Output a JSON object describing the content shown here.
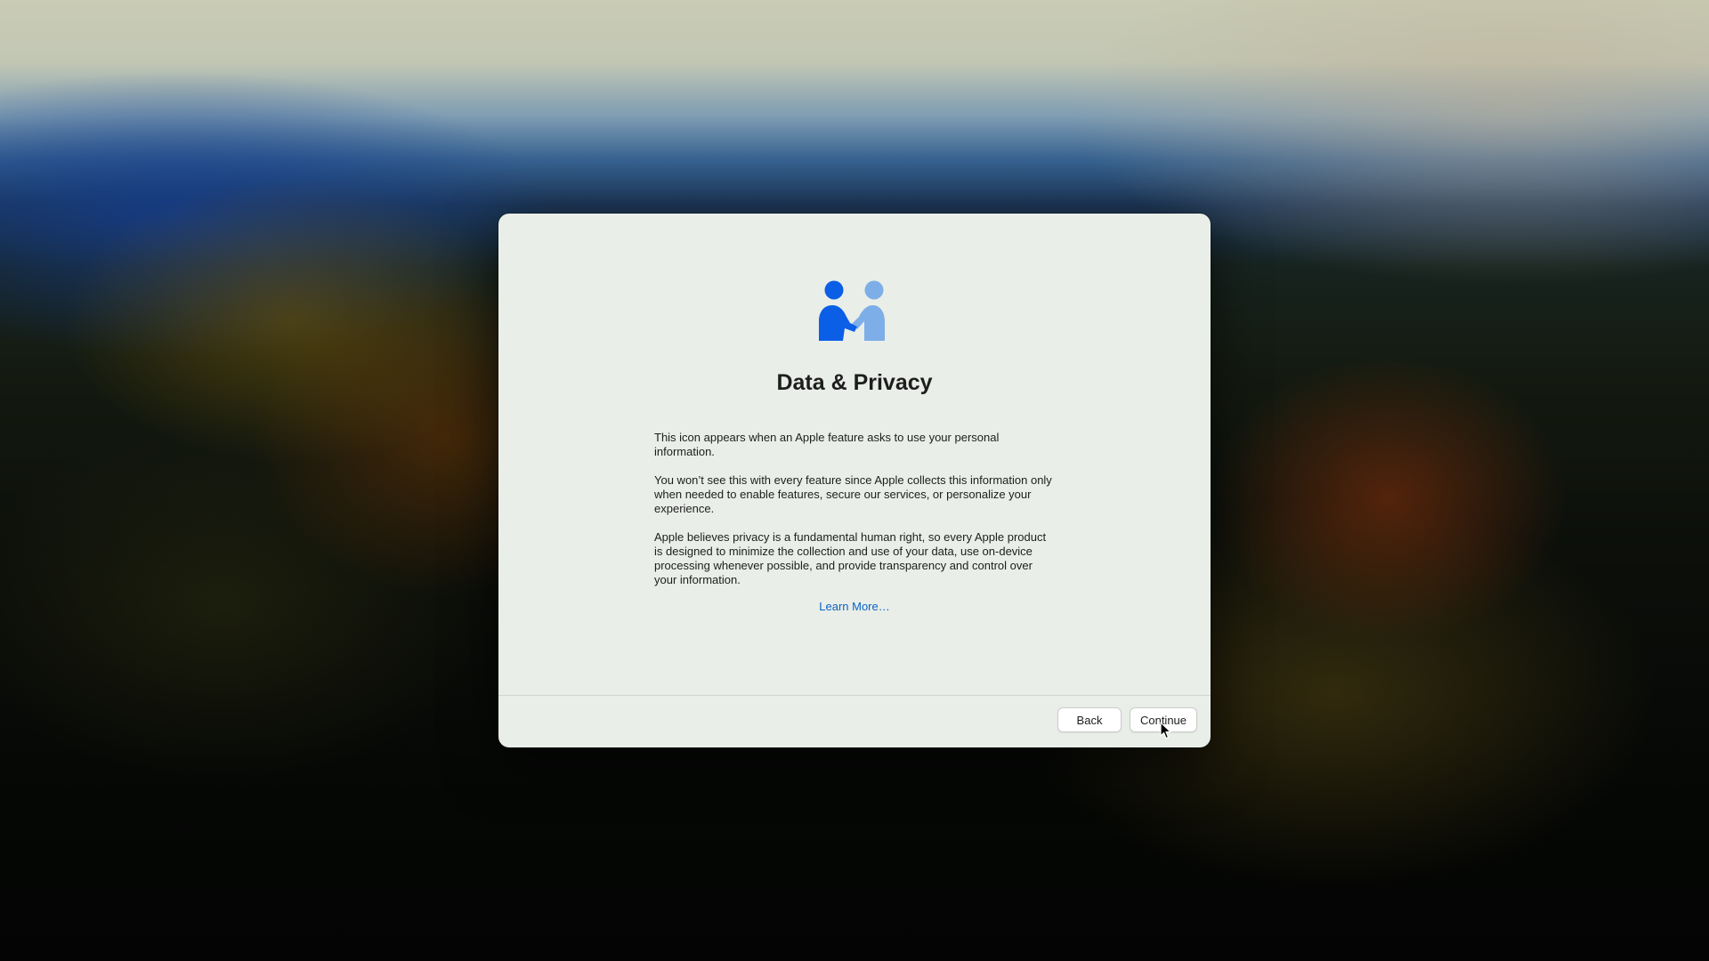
{
  "setup": {
    "title": "Data & Privacy",
    "paragraphs": [
      "This icon appears when an Apple feature asks to use your personal information.",
      "You won’t see this with every feature since Apple collects this information only when needed to enable features, secure our services, or personalize your experience.",
      "Apple believes privacy is a fundamental human right, so every Apple product is designed to minimize the collection and use of your data, use on-device processing whenever possible, and provide transparency and control over your information."
    ],
    "learn_more_label": "Learn More…",
    "hero_icon": "handshake-people-icon",
    "back_label": "Back",
    "continue_label": "Continue"
  },
  "colors": {
    "icon_primary": "#0a5fe6",
    "icon_secondary": "#7eaee8",
    "link": "#0a64c8",
    "dialog_background": "#e9eee8"
  },
  "pointer": "arrow-cursor-icon"
}
